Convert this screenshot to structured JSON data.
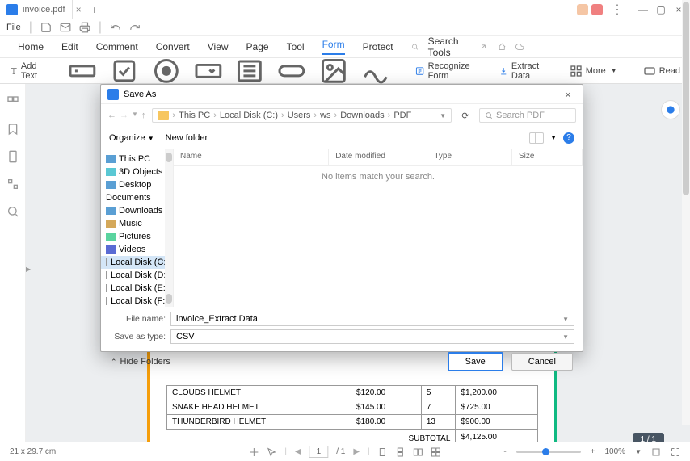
{
  "tab": {
    "title": "invoice.pdf"
  },
  "file_label": "File",
  "menu": {
    "home": "Home",
    "edit": "Edit",
    "comment": "Comment",
    "convert": "Convert",
    "view": "View",
    "page": "Page",
    "tool": "Tool",
    "form": "Form",
    "protect": "Protect",
    "search_placeholder": "Search Tools"
  },
  "toolbar": {
    "add_text": "Add Text",
    "recognize": "Recognize Form",
    "extract": "Extract Data",
    "more": "More",
    "read": "Read"
  },
  "dialog": {
    "title": "Save As",
    "breadcrumb": [
      "This PC",
      "Local Disk (C:)",
      "Users",
      "ws",
      "Downloads",
      "PDF"
    ],
    "search_placeholder": "Search PDF",
    "organize": "Organize",
    "new_folder": "New folder",
    "columns": {
      "name": "Name",
      "date": "Date modified",
      "type": "Type",
      "size": "Size"
    },
    "empty": "No items match your search.",
    "tree": [
      {
        "label": "This PC",
        "icon": "pc"
      },
      {
        "label": "3D Objects",
        "icon": "obj"
      },
      {
        "label": "Desktop",
        "icon": "desk"
      },
      {
        "label": "Documents",
        "icon": "doc"
      },
      {
        "label": "Downloads",
        "icon": "dl"
      },
      {
        "label": "Music",
        "icon": "music"
      },
      {
        "label": "Pictures",
        "icon": "pic"
      },
      {
        "label": "Videos",
        "icon": "vid"
      },
      {
        "label": "Local Disk (C:)",
        "icon": "disk",
        "selected": true
      },
      {
        "label": "Local Disk (D:)",
        "icon": "disk"
      },
      {
        "label": "Local Disk (E:)",
        "icon": "disk"
      },
      {
        "label": "Local Disk (F:)",
        "icon": "disk"
      }
    ],
    "file_name_label": "File name:",
    "file_name_value": "invoice_Extract Data",
    "save_type_label": "Save as type:",
    "save_type_value": "CSV",
    "hide_folders": "Hide Folders",
    "save": "Save",
    "cancel": "Cancel"
  },
  "doc": {
    "rows": [
      {
        "name": "CLOUDS HELMET",
        "price": "$120.00",
        "qty": "5",
        "total": "$1,200.00"
      },
      {
        "name": "SNAKE HEAD HELMET",
        "price": "$145.00",
        "qty": "7",
        "total": "$725.00"
      },
      {
        "name": "THUNDERBIRD HELMET",
        "price": "$180.00",
        "qty": "13",
        "total": "$900.00"
      }
    ],
    "subtotal_label": "SUBTOTAL",
    "subtotal_value": "$4,125.00"
  },
  "status": {
    "dimensions": "21 x 29.7 cm",
    "page": "1",
    "page_total": "/ 1",
    "zoom": "100%",
    "page_pill": "1 / 1"
  }
}
